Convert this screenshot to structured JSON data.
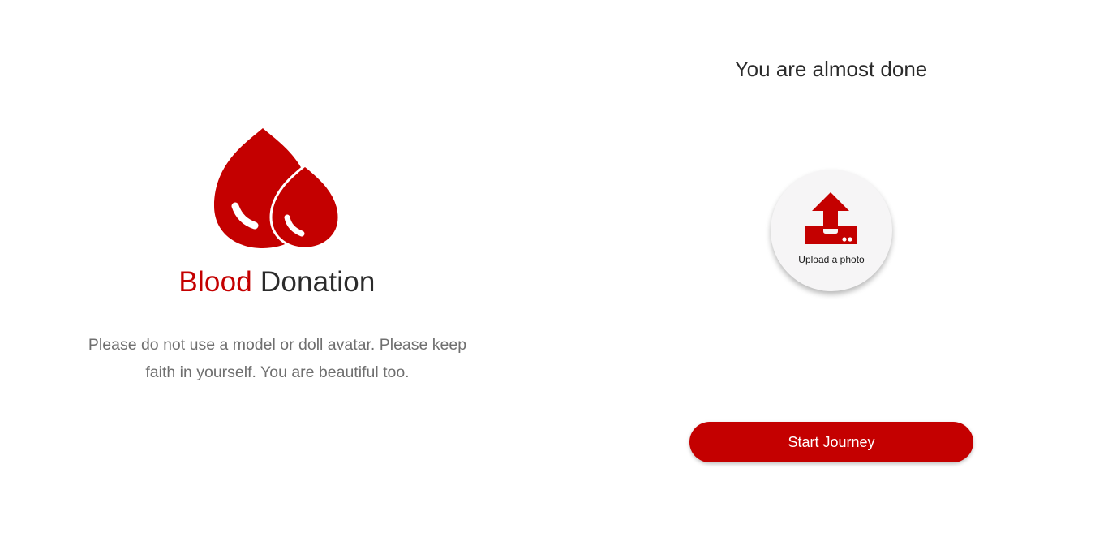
{
  "brand": {
    "accent_word": "Blood",
    "rest_word": "Donation",
    "logo_icon": "blood-drops-icon",
    "accent_color": "#c40000"
  },
  "left": {
    "disclaimer": "Please do not use a model or doll avatar. Please keep faith in yourself. You are beautiful too."
  },
  "right": {
    "heading": "You are almost done",
    "upload": {
      "label": "Upload a photo",
      "icon": "upload-icon"
    },
    "cta_label": "Start Journey"
  }
}
